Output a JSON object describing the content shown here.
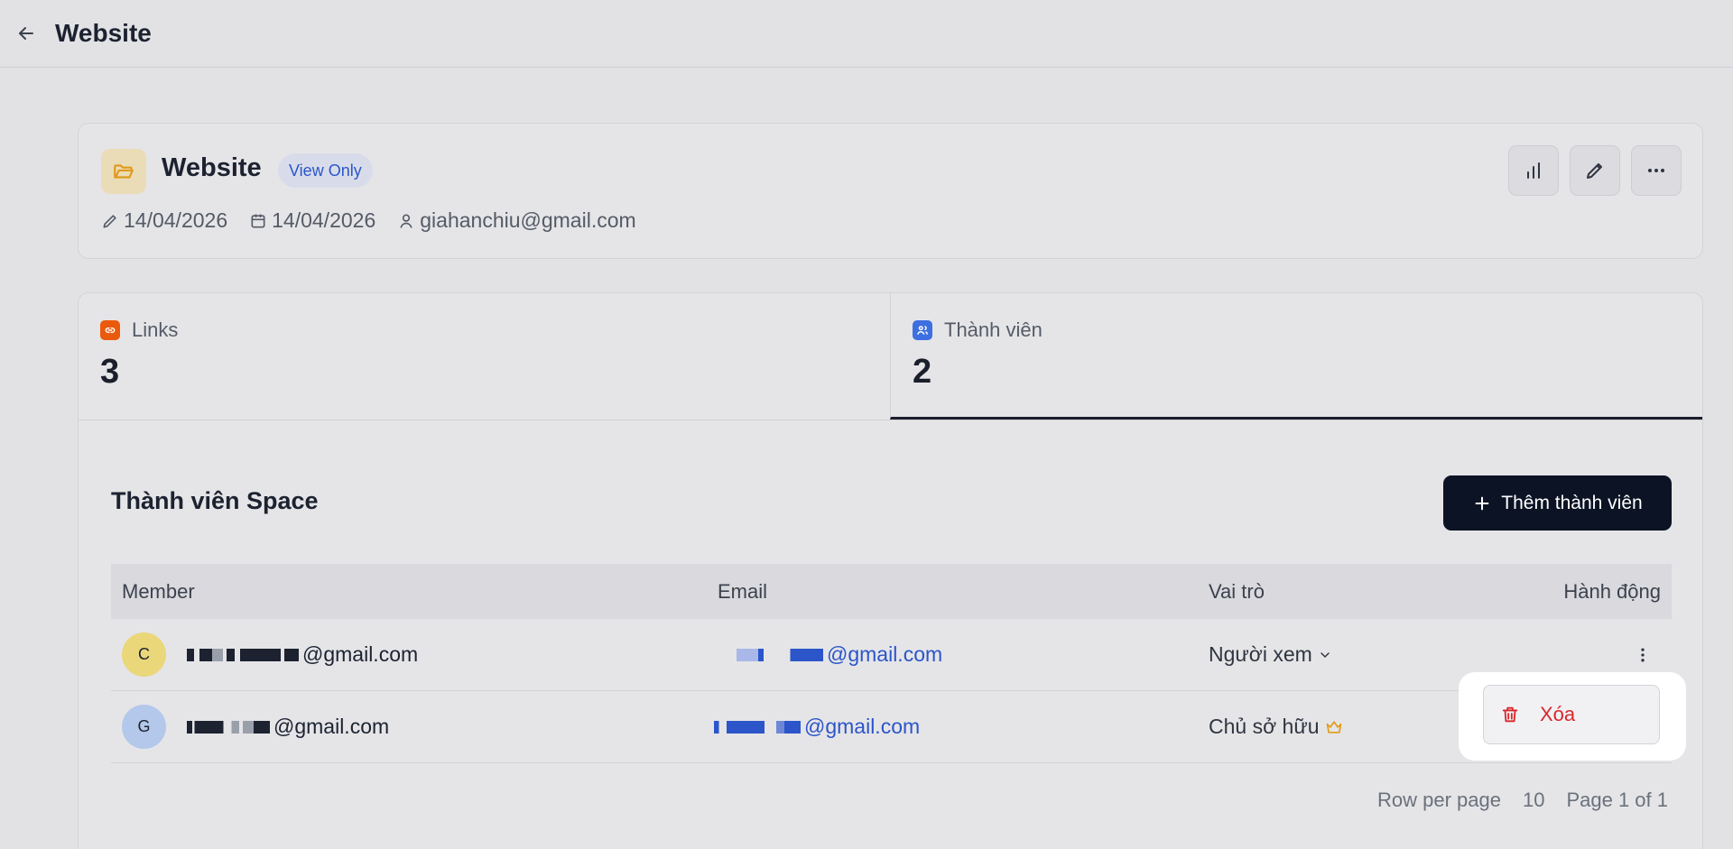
{
  "header": {
    "title": "Website"
  },
  "space": {
    "name": "Website",
    "badge": "View Only",
    "edited": "14/04/2026",
    "created": "14/04/2026",
    "owner": "giahanchiu@gmail.com"
  },
  "stats": [
    {
      "label": "Links",
      "value": "3",
      "icon": "link-icon",
      "color": "#ea5a0c"
    },
    {
      "label": "Thành viên",
      "value": "2",
      "icon": "users-icon",
      "color": "#3d6fe0"
    }
  ],
  "members_section": {
    "title": "Thành viên Space",
    "add_button": "Thêm thành viên",
    "columns": {
      "member": "Member",
      "email": "Email",
      "role": "Vai trò",
      "actions": "Hành động"
    },
    "rows": [
      {
        "avatar": "C",
        "avatar_color": "#e9d77a",
        "name_suffix": "@gmail.com",
        "email_suffix": "@gmail.com",
        "role": "Người xem"
      },
      {
        "avatar": "G",
        "avatar_color": "#b3c8ea",
        "name_suffix": "@gmail.com",
        "email_suffix": "@gmail.com",
        "role": "Chủ sở hữu"
      }
    ]
  },
  "pagination": {
    "rows_label": "Row per page",
    "rows_value": "10",
    "page_label": "Page 1 of 1"
  },
  "row_menu": {
    "delete_label": "Xóa"
  },
  "colors": {
    "accent": "#0b1324",
    "link": "#2b55c9",
    "danger": "#d8272b",
    "crown": "#e39b17"
  }
}
